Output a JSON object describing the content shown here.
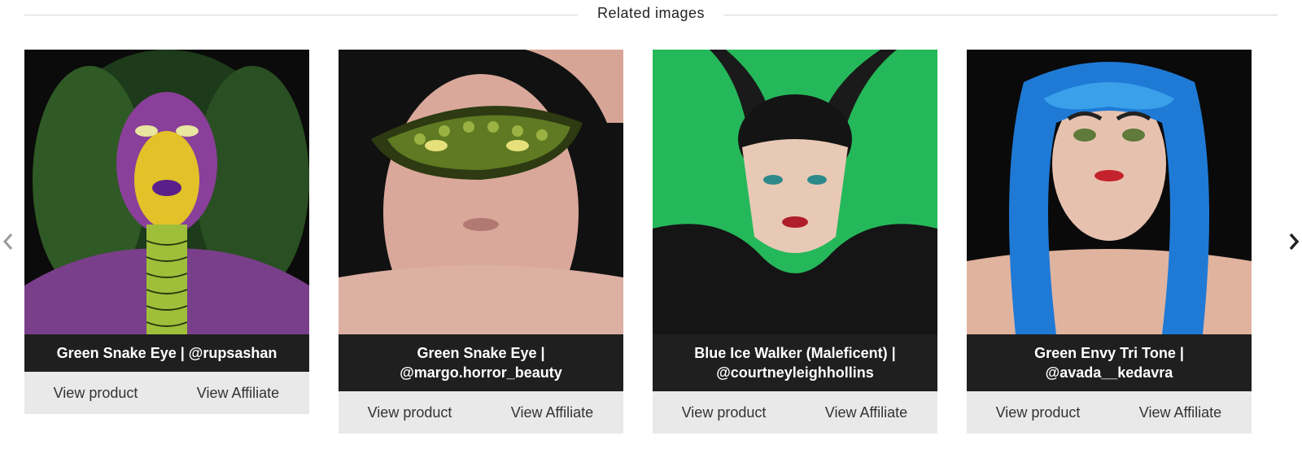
{
  "section": {
    "title": "Related images"
  },
  "cards": [
    {
      "title": "Green Snake Eye | @rupsashan",
      "view_product": "View product",
      "view_affiliate": "View Affiliate",
      "image_desc": "snake-makeup-photo"
    },
    {
      "title": "Green Snake Eye | @margo.horror_beauty",
      "view_product": "View product",
      "view_affiliate": "View Affiliate",
      "image_desc": "snake-mask-photo"
    },
    {
      "title": "Blue Ice Walker (Maleficent) | @courtneyleighhollins",
      "view_product": "View product",
      "view_affiliate": "View Affiliate",
      "image_desc": "maleficent-photo"
    },
    {
      "title": "Green Envy Tri Tone | @avada__kedavra",
      "view_product": "View product",
      "view_affiliate": "View Affiliate",
      "image_desc": "blue-hair-photo"
    }
  ],
  "nav": {
    "prev_icon": "chevron-left-icon",
    "next_icon": "chevron-right-icon"
  },
  "colors": {
    "caption_bg": "#1f1f1f",
    "actions_bg": "#e9e9e9",
    "divider": "#d6d6d6"
  }
}
